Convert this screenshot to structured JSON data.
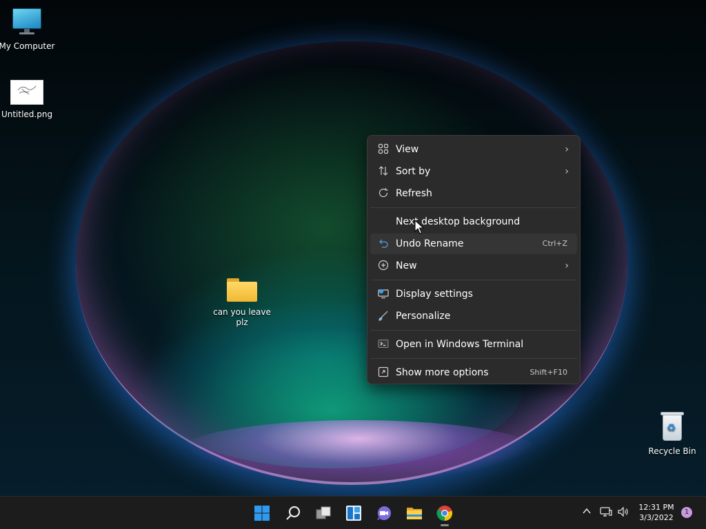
{
  "desktop": {
    "icons": [
      {
        "label": "My Computer",
        "icon": "monitor-icon"
      },
      {
        "label": "Untitled.png",
        "icon": "image-thumbnail-icon"
      },
      {
        "label": "can you leave\nplz",
        "icon": "folder-icon"
      },
      {
        "label": "Recycle Bin",
        "icon": "recycle-bin-icon"
      }
    ]
  },
  "context_menu": {
    "items": [
      {
        "label": "View",
        "icon": "view-grid-icon",
        "submenu": true
      },
      {
        "label": "Sort by",
        "icon": "sort-icon",
        "submenu": true
      },
      {
        "label": "Refresh",
        "icon": "refresh-icon"
      },
      {
        "label": "Next desktop background",
        "icon": ""
      },
      {
        "label": "Undo Rename",
        "icon": "undo-icon",
        "shortcut": "Ctrl+Z"
      },
      {
        "label": "New",
        "icon": "new-plus-icon",
        "submenu": true
      },
      {
        "label": "Display settings",
        "icon": "display-settings-icon"
      },
      {
        "label": "Personalize",
        "icon": "brush-icon"
      },
      {
        "label": "Open in Windows Terminal",
        "icon": "terminal-icon"
      },
      {
        "label": "Show more options",
        "icon": "more-options-icon",
        "shortcut": "Shift+F10"
      }
    ],
    "hovered": "Undo Rename"
  },
  "taskbar": {
    "apps": [
      {
        "name": "start-button",
        "icon": "windows-logo-icon"
      },
      {
        "name": "search-button",
        "icon": "search-icon"
      },
      {
        "name": "task-view-button",
        "icon": "task-view-icon"
      },
      {
        "name": "widgets-button",
        "icon": "widgets-icon"
      },
      {
        "name": "chat-button",
        "icon": "teams-chat-icon"
      },
      {
        "name": "file-explorer-button",
        "icon": "folder-icon"
      },
      {
        "name": "chrome-button",
        "icon": "chrome-icon",
        "running": true
      }
    ],
    "tray": {
      "overflow_icon": "chevron-up-icon",
      "network_icon": "network-icon",
      "volume_icon": "volume-icon",
      "time": "12:31 PM",
      "date": "3/3/2022",
      "notification_count": "1"
    }
  },
  "colors": {
    "menu_bg": "#2b2b2b",
    "taskbar_bg": "#1c1c1c",
    "accent_blue": "#1a8ad4",
    "notification_badge": "#c79adf"
  }
}
